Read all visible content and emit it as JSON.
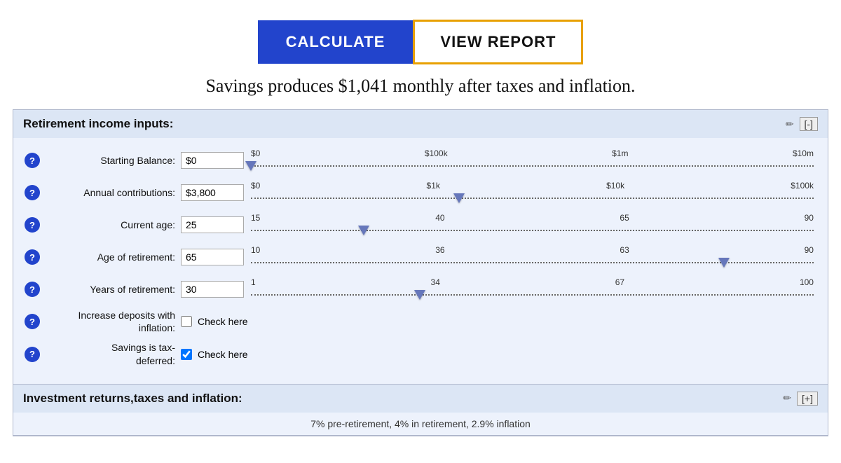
{
  "buttons": {
    "calculate_label": "CALCULATE",
    "view_report_label": "VIEW REPORT"
  },
  "summary": {
    "text": "Savings produces $1,041 monthly after taxes and inflation."
  },
  "retirement_section": {
    "title": "Retirement income inputs:",
    "collapse_label": "[-]",
    "edit_icon": "✏",
    "fields": [
      {
        "label": "Starting Balance:",
        "value": "$0",
        "slider_labels": [
          "$0",
          "$100k",
          "$1m",
          "$10m"
        ],
        "thumb_pct": 0
      },
      {
        "label": "Annual contributions:",
        "value": "$3,800",
        "slider_labels": [
          "$0",
          "$1k",
          "$10k",
          "$100k"
        ],
        "thumb_pct": 37
      },
      {
        "label": "Current age:",
        "value": "25",
        "slider_labels": [
          "15",
          "40",
          "65",
          "90"
        ],
        "thumb_pct": 20
      },
      {
        "label": "Age of retirement:",
        "value": "65",
        "slider_labels": [
          "10",
          "36",
          "63",
          "90"
        ],
        "thumb_pct": 84
      },
      {
        "label": "Years of retirement:",
        "value": "30",
        "slider_labels": [
          "1",
          "34",
          "67",
          "100"
        ],
        "thumb_pct": 30
      }
    ],
    "checkboxes": [
      {
        "label": "Increase deposits with\ninflation:",
        "check_label": "Check here",
        "checked": false
      },
      {
        "label": "Savings is tax-\ndeferred:",
        "check_label": "Check here",
        "checked": true
      }
    ]
  },
  "investment_section": {
    "title": "Investment returns,taxes and inflation:",
    "expand_label": "[+]",
    "edit_icon": "✏",
    "sub_text": "7% pre-retirement, 4% in retirement, 2.9% inflation"
  }
}
